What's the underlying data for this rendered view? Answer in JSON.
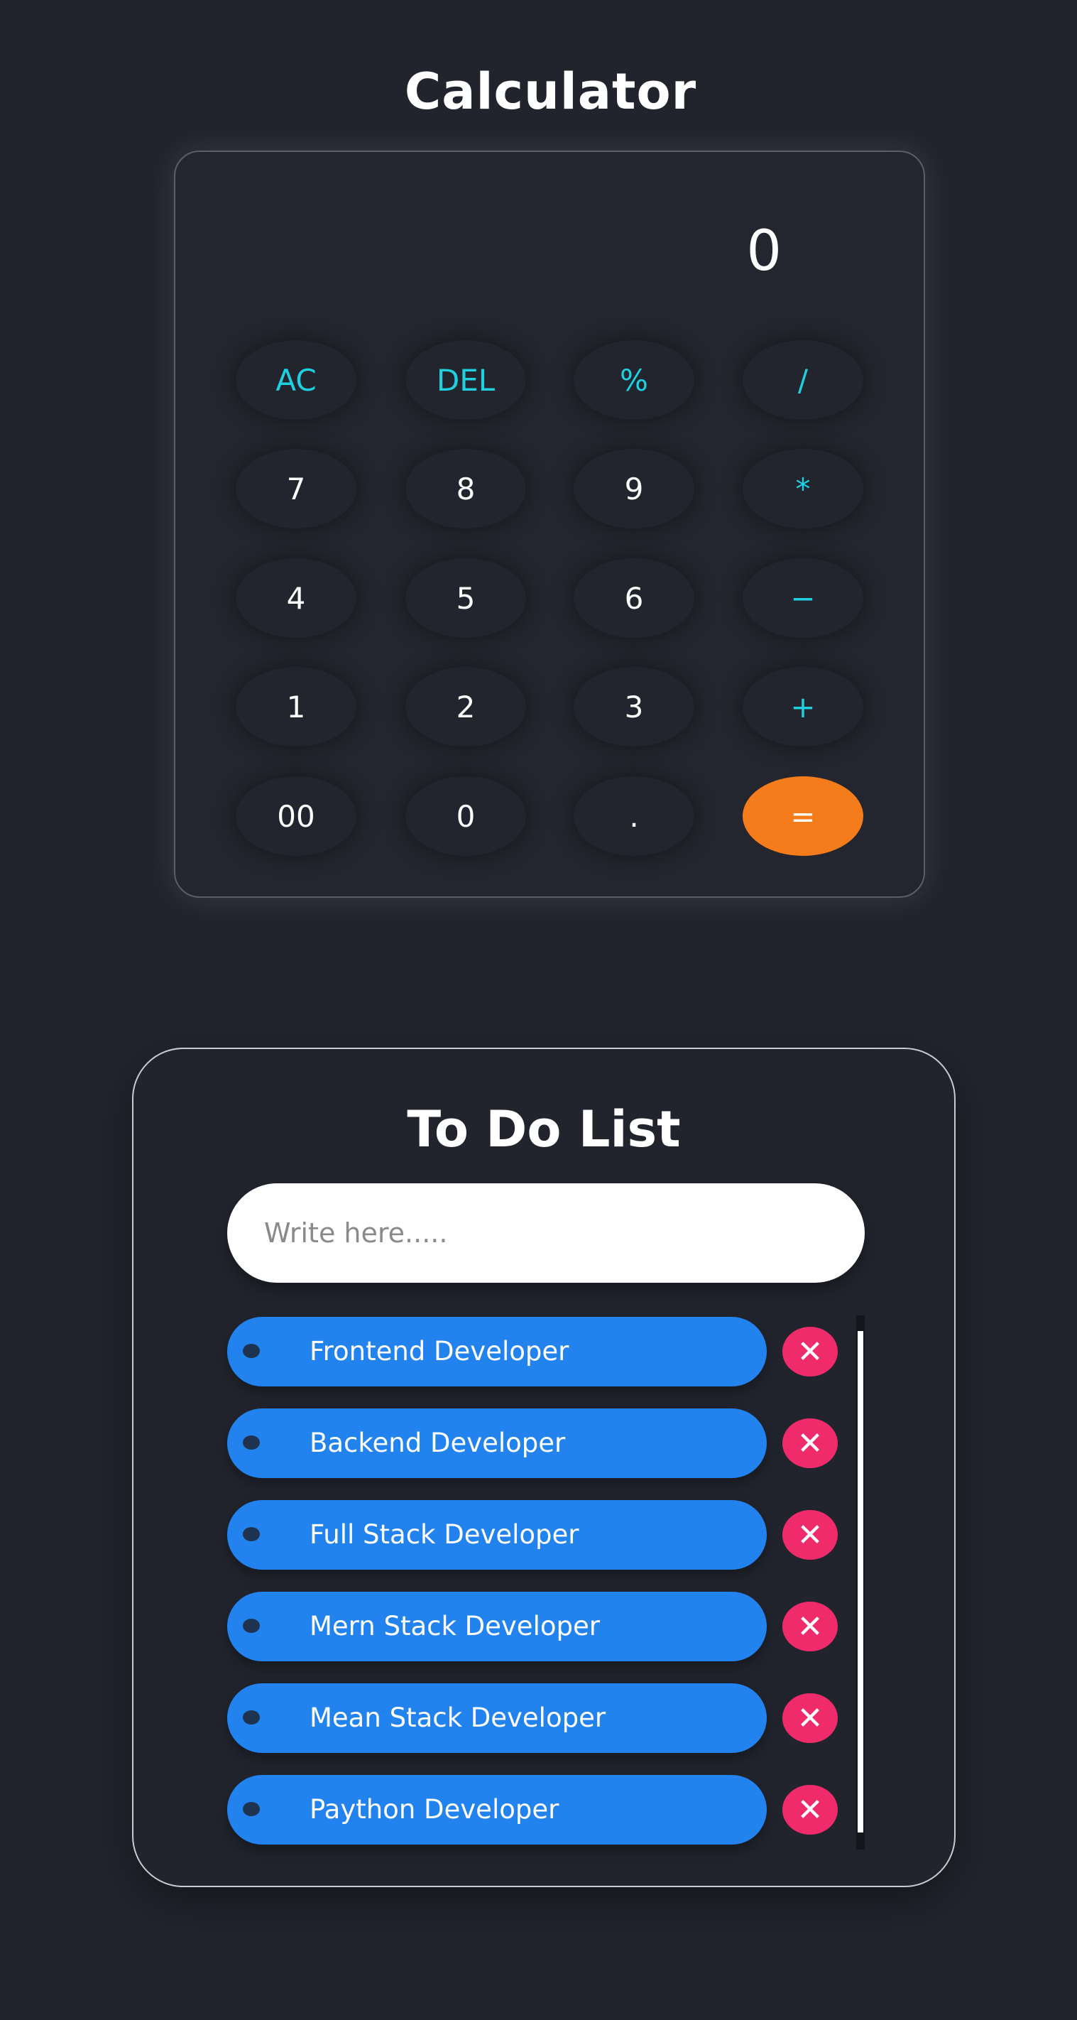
{
  "calculator": {
    "title": "Calculator",
    "display": "0",
    "buttons": [
      {
        "label": "AC",
        "type": "op"
      },
      {
        "label": "DEL",
        "type": "op"
      },
      {
        "label": "%",
        "type": "op"
      },
      {
        "label": "/",
        "type": "op"
      },
      {
        "label": "7",
        "type": "num"
      },
      {
        "label": "8",
        "type": "num"
      },
      {
        "label": "9",
        "type": "num"
      },
      {
        "label": "*",
        "type": "op"
      },
      {
        "label": "4",
        "type": "num"
      },
      {
        "label": "5",
        "type": "num"
      },
      {
        "label": "6",
        "type": "num"
      },
      {
        "label": "−",
        "type": "op"
      },
      {
        "label": "1",
        "type": "num"
      },
      {
        "label": "2",
        "type": "num"
      },
      {
        "label": "3",
        "type": "num"
      },
      {
        "label": "+",
        "type": "op"
      },
      {
        "label": "00",
        "type": "num"
      },
      {
        "label": "0",
        "type": "num"
      },
      {
        "label": ".",
        "type": "num"
      },
      {
        "label": "=",
        "type": "eq"
      }
    ]
  },
  "todo": {
    "title": "To Do List",
    "input_placeholder": "Write here.....",
    "items": [
      "Frontend Developer",
      "Backend Developer",
      "Full Stack Developer",
      "Mern Stack Developer",
      "Mean Stack Developer",
      "Paython Developer"
    ],
    "delete_icon": "✕"
  },
  "colors": {
    "background": "#21242d",
    "accent_cyan": "#1fd0e0",
    "equals_orange": "#f47c1b",
    "todo_blue": "#2283ee",
    "delete_pink": "#ef2b6b"
  }
}
